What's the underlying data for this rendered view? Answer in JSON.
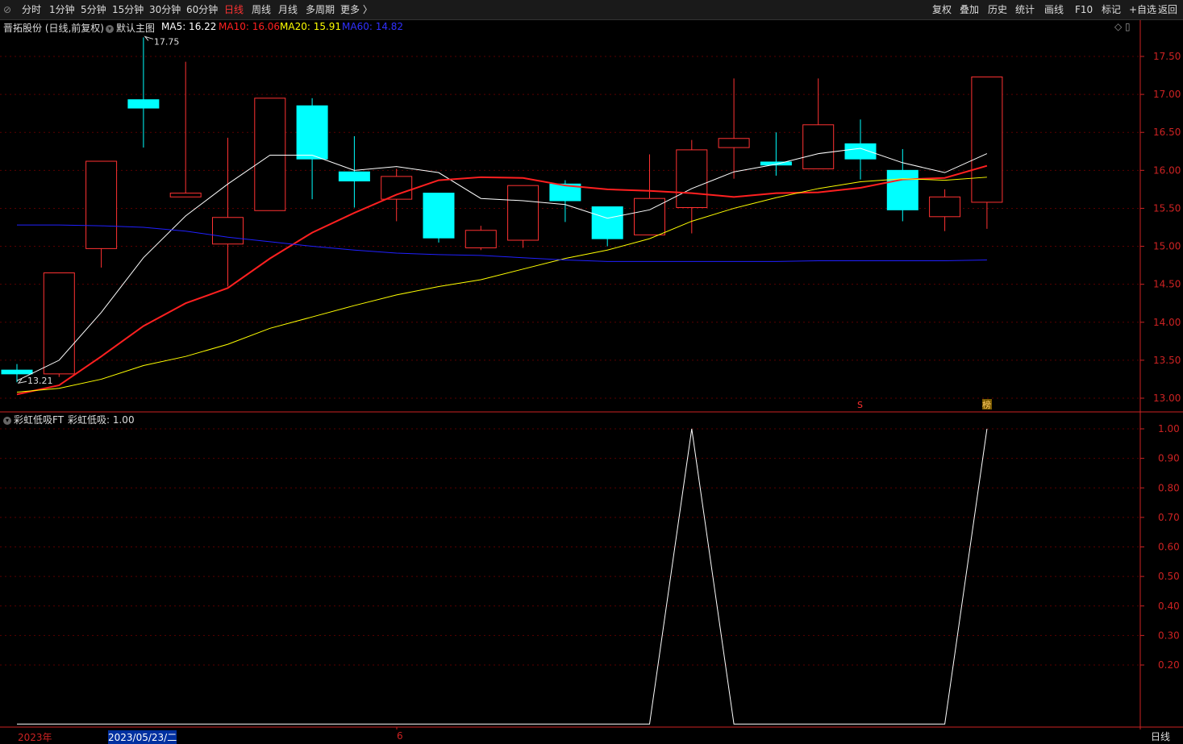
{
  "toolbar": {
    "left_icon": "collapse-icon",
    "periods": [
      "分时",
      "1分钟",
      "5分钟",
      "15分钟",
      "30分钟",
      "60分钟",
      "日线",
      "周线",
      "月线",
      "多周期",
      "更多 〉"
    ],
    "active_period": "日线",
    "right_buttons": [
      "复权",
      "叠加",
      "历史",
      "统计",
      "画线",
      "F10",
      "标记",
      "+自选",
      "返回"
    ]
  },
  "main_panel": {
    "title": "晋拓股份 (日线,前复权)",
    "template": "默认主图",
    "ma5_label": "MA5: 16.22",
    "ma10_label": "MA10: 16.06",
    "ma20_label": "MA20: 15.91",
    "ma60_label": "MA60: 14.82",
    "high_marker": "17.75",
    "low_marker": "13.21",
    "marker_s": "S",
    "marker_bang": "榜"
  },
  "sub_panel": {
    "title": "彩虹低吸FT",
    "value_label": "彩虹低吸: 1.00"
  },
  "date_axis": {
    "year": "2023年",
    "cursor_date": "2023/05/23/二",
    "month": "6",
    "period_tag": "日线"
  },
  "colors": {
    "up": "#ff3232",
    "down": "#00ffff",
    "ma5": "#ffffff",
    "ma10": "#ff2020",
    "ma20": "#ffff00",
    "ma60": "#2020ff",
    "axis": "#cc2222"
  },
  "chart_data": [
    {
      "type": "candlestick",
      "title": "晋拓股份 (日线,前复权)",
      "y_ticks": [
        13.0,
        13.5,
        14.0,
        14.5,
        15.0,
        15.5,
        16.0,
        16.5,
        17.0,
        17.5
      ],
      "ylim": [
        12.85,
        17.85
      ],
      "candles": [
        {
          "o": 13.37,
          "c": 13.32,
          "h": 13.45,
          "l": 13.21
        },
        {
          "o": 13.32,
          "c": 14.65,
          "h": 14.65,
          "l": 13.28
        },
        {
          "o": 14.97,
          "c": 16.12,
          "h": 16.12,
          "l": 14.72
        },
        {
          "o": 16.93,
          "c": 16.82,
          "h": 17.75,
          "l": 16.3
        },
        {
          "o": 15.65,
          "c": 15.7,
          "h": 17.43,
          "l": 15.65
        },
        {
          "o": 15.03,
          "c": 15.38,
          "h": 16.43,
          "l": 14.47
        },
        {
          "o": 15.47,
          "c": 16.95,
          "h": 16.95,
          "l": 15.47
        },
        {
          "o": 16.85,
          "c": 16.15,
          "h": 16.95,
          "l": 15.62
        },
        {
          "o": 15.98,
          "c": 15.86,
          "h": 16.45,
          "l": 15.51
        },
        {
          "o": 15.62,
          "c": 15.92,
          "h": 16.02,
          "l": 15.33
        },
        {
          "o": 15.7,
          "c": 15.11,
          "h": 15.7,
          "l": 15.05
        },
        {
          "o": 14.98,
          "c": 15.21,
          "h": 15.27,
          "l": 14.95
        },
        {
          "o": 15.08,
          "c": 15.8,
          "h": 15.8,
          "l": 14.98
        },
        {
          "o": 15.82,
          "c": 15.6,
          "h": 15.87,
          "l": 15.32
        },
        {
          "o": 15.52,
          "c": 15.1,
          "h": 15.52,
          "l": 15.0
        },
        {
          "o": 15.15,
          "c": 15.63,
          "h": 16.21,
          "l": 15.15
        },
        {
          "o": 15.51,
          "c": 16.27,
          "h": 16.4,
          "l": 15.17
        },
        {
          "o": 16.3,
          "c": 16.42,
          "h": 17.21,
          "l": 15.89
        },
        {
          "o": 16.11,
          "c": 16.07,
          "h": 16.5,
          "l": 15.93
        },
        {
          "o": 16.02,
          "c": 16.6,
          "h": 17.21,
          "l": 16.02
        },
        {
          "o": 16.35,
          "c": 16.15,
          "h": 16.67,
          "l": 15.88
        },
        {
          "o": 16.0,
          "c": 15.48,
          "h": 16.28,
          "l": 15.33
        },
        {
          "o": 15.39,
          "c": 15.65,
          "h": 15.75,
          "l": 15.2
        },
        {
          "o": 15.58,
          "c": 17.23,
          "h": 17.23,
          "l": 15.23
        }
      ],
      "series": [
        {
          "name": "MA5",
          "values": [
            13.23,
            13.5,
            14.13,
            14.85,
            15.4,
            15.82,
            16.2,
            16.2,
            16.0,
            16.05,
            15.97,
            15.63,
            15.6,
            15.55,
            15.37,
            15.48,
            15.76,
            15.98,
            16.08,
            16.22,
            16.29,
            16.1,
            15.97,
            16.22
          ]
        },
        {
          "name": "MA10",
          "values": [
            13.05,
            13.17,
            13.55,
            13.95,
            14.25,
            14.45,
            14.84,
            15.18,
            15.44,
            15.68,
            15.87,
            15.91,
            15.9,
            15.8,
            15.75,
            15.73,
            15.7,
            15.65,
            15.7,
            15.71,
            15.77,
            15.88,
            15.9,
            16.06
          ]
        },
        {
          "name": "MA20",
          "values": [
            13.08,
            13.13,
            13.25,
            13.43,
            13.55,
            13.71,
            13.92,
            14.07,
            14.22,
            14.36,
            14.47,
            14.56,
            14.7,
            14.84,
            14.95,
            15.1,
            15.33,
            15.5,
            15.64,
            15.76,
            15.85,
            15.89,
            15.87,
            15.91
          ]
        },
        {
          "name": "MA60",
          "values": [
            15.28,
            15.28,
            15.27,
            15.25,
            15.2,
            15.12,
            15.06,
            15.0,
            14.95,
            14.91,
            14.89,
            14.88,
            14.85,
            14.82,
            14.8,
            14.8,
            14.8,
            14.8,
            14.8,
            14.81,
            14.81,
            14.81,
            14.81,
            14.82
          ]
        }
      ]
    },
    {
      "type": "line",
      "title": "彩虹低吸FT",
      "y_ticks": [
        0.2,
        0.3,
        0.4,
        0.5,
        0.6,
        0.7,
        0.8,
        0.9,
        1.0
      ],
      "ylim": [
        0,
        1.05
      ],
      "series": [
        {
          "name": "彩虹低吸",
          "values": [
            0,
            0,
            0,
            0,
            0,
            0,
            0,
            0,
            0,
            0,
            0,
            0,
            0,
            0,
            0,
            0,
            1,
            0,
            0,
            0,
            0,
            0,
            0,
            1
          ]
        }
      ]
    }
  ]
}
